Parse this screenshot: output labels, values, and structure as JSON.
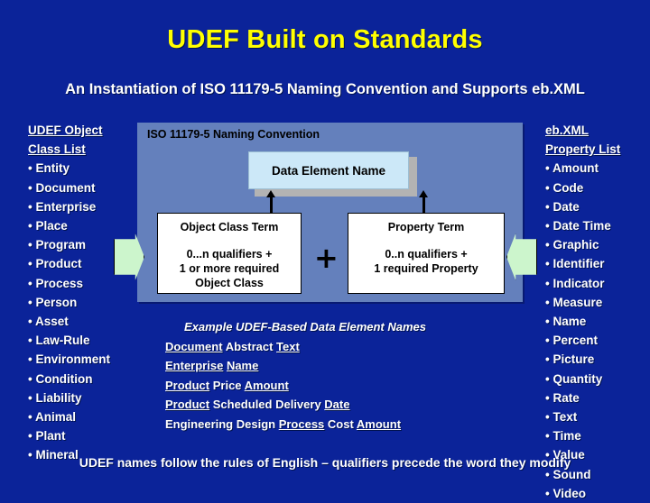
{
  "colors": {
    "background": "#0b2399",
    "title_text": "#ffff00",
    "body_text": "#ffffff",
    "panel_fill": "#6480bc",
    "data_element_fill": "#cce8f8",
    "term_box_fill": "#ffffff",
    "arrow_fill": "#ccf5cc"
  },
  "slide": {
    "title": "UDEF Built on Standards",
    "subtitle": "An Instantiation of ISO 11179-5 Naming Convention and Supports eb.XML",
    "footer": "UDEF names follow the rules of English – qualifiers precede the word they modify"
  },
  "object_class_list": {
    "heading_line1": "UDEF Object",
    "heading_line2": "Class List",
    "items": [
      "• Entity",
      "• Document",
      "• Enterprise",
      "• Place",
      "• Program",
      "• Product",
      "• Process",
      "• Person",
      "• Asset",
      "• Law-Rule",
      "• Environment",
      "• Condition",
      "• Liability",
      "• Animal",
      "• Plant",
      "• Mineral"
    ]
  },
  "property_list": {
    "heading_line1": "eb.XML",
    "heading_line2": "Property List",
    "items": [
      "• Amount",
      "• Code",
      "• Date",
      "• Date Time",
      "• Graphic",
      "• Identifier",
      "• Indicator",
      "• Measure",
      "• Name",
      "• Percent",
      "• Picture",
      "• Quantity",
      "• Rate",
      "• Text",
      "• Time",
      "• Value",
      "• Sound",
      "• Video"
    ]
  },
  "center_panel": {
    "iso_label": "ISO 11179-5 Naming Convention",
    "data_element_name": "Data Element Name",
    "plus": "+",
    "object_class_term": {
      "title": "Object Class Term",
      "detail_line1": "0...n qualifiers +",
      "detail_line2": "1 or more required",
      "detail_line3": "Object Class"
    },
    "property_term": {
      "title": "Property Term",
      "detail_line1": "0..n qualifiers +",
      "detail_line2": "1 required Property",
      "detail_line3": ""
    }
  },
  "examples": {
    "heading": "Example UDEF-Based Data Element Names",
    "lines": [
      {
        "parts": [
          {
            "t": "Document",
            "u": true
          },
          {
            "t": " Abstract ",
            "u": false
          },
          {
            "t": "Text",
            "u": true
          }
        ]
      },
      {
        "parts": [
          {
            "t": "Enterprise",
            "u": true
          },
          {
            "t": " ",
            "u": false
          },
          {
            "t": "Name",
            "u": true
          }
        ]
      },
      {
        "parts": [
          {
            "t": "Product",
            "u": true
          },
          {
            "t": " Price ",
            "u": false
          },
          {
            "t": "Amount",
            "u": true
          }
        ]
      },
      {
        "parts": [
          {
            "t": "Product",
            "u": true
          },
          {
            "t": " Scheduled Delivery ",
            "u": false
          },
          {
            "t": "Date",
            "u": true
          }
        ]
      },
      {
        "parts": [
          {
            "t": "Engineering Design ",
            "u": false
          },
          {
            "t": "Process",
            "u": true
          },
          {
            "t": " Cost ",
            "u": false
          },
          {
            "t": "Amount",
            "u": true
          }
        ]
      }
    ]
  },
  "icons": {
    "arrow_left": "right-pointing-block-arrow-icon",
    "arrow_right": "left-pointing-block-arrow-icon",
    "up_arrow": "up-arrow-icon"
  }
}
